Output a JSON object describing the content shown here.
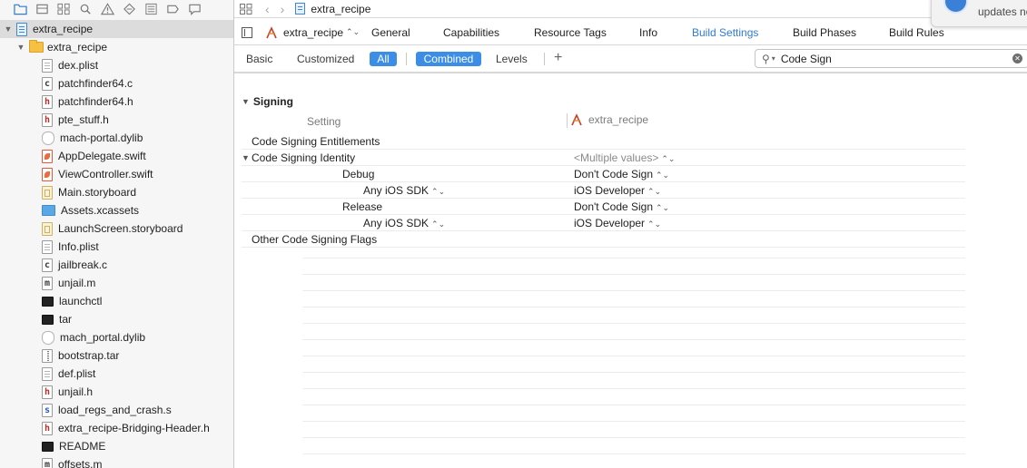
{
  "navigator": {
    "project": "extra_recipe",
    "group": "extra_recipe",
    "files": [
      {
        "name": "dex.plist",
        "type": "plist"
      },
      {
        "name": "patchfinder64.c",
        "type": "c"
      },
      {
        "name": "patchfinder64.h",
        "type": "h"
      },
      {
        "name": "pte_stuff.h",
        "type": "h"
      },
      {
        "name": "mach-portal.dylib",
        "type": "dylib"
      },
      {
        "name": "AppDelegate.swift",
        "type": "swift"
      },
      {
        "name": "ViewController.swift",
        "type": "swift"
      },
      {
        "name": "Main.storyboard",
        "type": "storyboard"
      },
      {
        "name": "Assets.xcassets",
        "type": "xcassets"
      },
      {
        "name": "LaunchScreen.storyboard",
        "type": "storyboard"
      },
      {
        "name": "Info.plist",
        "type": "plist"
      },
      {
        "name": "jailbreak.c",
        "type": "c"
      },
      {
        "name": "unjail.m",
        "type": "m"
      },
      {
        "name": "launchctl",
        "type": "terminal"
      },
      {
        "name": "tar",
        "type": "terminal"
      },
      {
        "name": "mach_portal.dylib",
        "type": "dylib"
      },
      {
        "name": "bootstrap.tar",
        "type": "archive"
      },
      {
        "name": "def.plist",
        "type": "plist"
      },
      {
        "name": "unjail.h",
        "type": "h"
      },
      {
        "name": "load_regs_and_crash.s",
        "type": "s"
      },
      {
        "name": "extra_recipe-Bridging-Header.h",
        "type": "h"
      },
      {
        "name": "README",
        "type": "terminal"
      },
      {
        "name": "offsets.m",
        "type": "m"
      }
    ],
    "icon_letters": {
      "c": "c",
      "h": "h",
      "m": "m",
      "s": "s"
    }
  },
  "jump_bar": {
    "crumb": "extra_recipe"
  },
  "tabs_bar": {
    "target": "extra_recipe",
    "tabs": [
      "General",
      "Capabilities",
      "Resource Tags",
      "Info",
      "Build Settings",
      "Build Phases",
      "Build Rules"
    ],
    "active_tab": "Build Settings"
  },
  "filter_bar": {
    "basic": "Basic",
    "customized": "Customized",
    "all": "All",
    "combined": "Combined",
    "levels": "Levels",
    "search_value": "Code Sign"
  },
  "settings": {
    "section": "Signing",
    "col_setting": "Setting",
    "col_target": "extra_recipe",
    "rows": [
      {
        "name": "Code Signing Entitlements",
        "value": "",
        "indent": 0
      },
      {
        "name": "Code Signing Identity",
        "value": "<Multiple values>",
        "indent": 0,
        "expanded": true
      },
      {
        "name": "Debug",
        "value": "Don't Code Sign",
        "indent": 1
      },
      {
        "name": "Any iOS SDK",
        "value": "iOS Developer",
        "indent": 2
      },
      {
        "name": "Release",
        "value": "Don't Code Sign",
        "indent": 1
      },
      {
        "name": "Any iOS SDK",
        "value": "iOS Developer",
        "indent": 2
      },
      {
        "name": "Other Code Signing Flags",
        "value": "",
        "indent": 0
      }
    ]
  },
  "notification": {
    "text": "updates no"
  },
  "colors": {
    "accent": "#2f7bd5",
    "toggle_on": "#3b8de6"
  }
}
